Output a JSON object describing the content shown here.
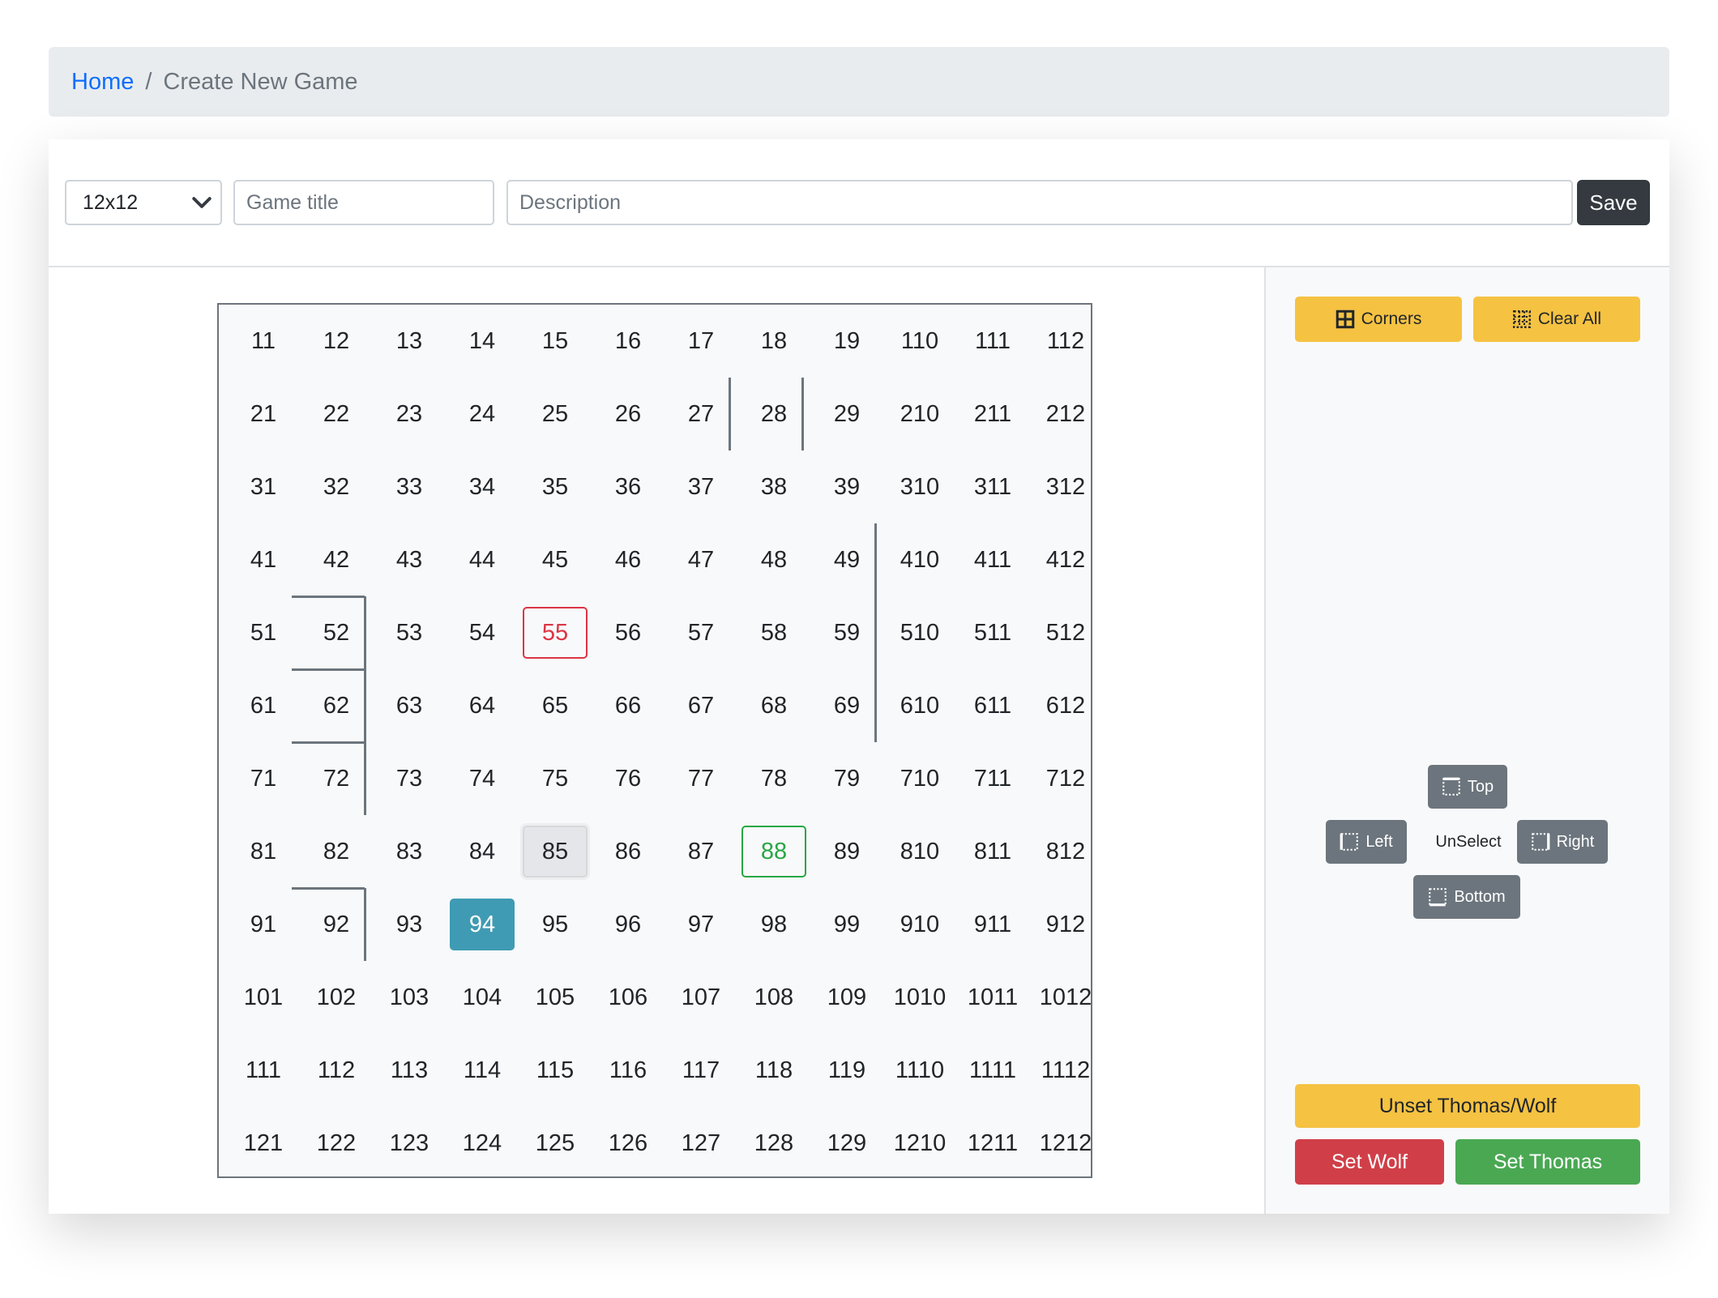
{
  "breadcrumb": {
    "home": "Home",
    "separator": "/",
    "current": "Create New Game"
  },
  "form": {
    "size_select": "12x12",
    "title_placeholder": "Game title",
    "description_placeholder": "Description",
    "save_label": "Save"
  },
  "board": {
    "rows": 12,
    "cols": 12,
    "highlighted": {
      "wolf_cell": "55",
      "thomas_cell": "88",
      "selected_cell": "85",
      "active_cell": "94"
    },
    "cells": [
      [
        "11",
        "12",
        "13",
        "14",
        "15",
        "16",
        "17",
        "18",
        "19",
        "110",
        "111",
        "112"
      ],
      [
        "21",
        "22",
        "23",
        "24",
        "25",
        "26",
        "27",
        "28",
        "29",
        "210",
        "211",
        "212"
      ],
      [
        "31",
        "32",
        "33",
        "34",
        "35",
        "36",
        "37",
        "38",
        "39",
        "310",
        "311",
        "312"
      ],
      [
        "41",
        "42",
        "43",
        "44",
        "45",
        "46",
        "47",
        "48",
        "49",
        "410",
        "411",
        "412"
      ],
      [
        "51",
        "52",
        "53",
        "54",
        "55",
        "56",
        "57",
        "58",
        "59",
        "510",
        "511",
        "512"
      ],
      [
        "61",
        "62",
        "63",
        "64",
        "65",
        "66",
        "67",
        "68",
        "69",
        "610",
        "611",
        "612"
      ],
      [
        "71",
        "72",
        "73",
        "74",
        "75",
        "76",
        "77",
        "78",
        "79",
        "710",
        "711",
        "712"
      ],
      [
        "81",
        "82",
        "83",
        "84",
        "85",
        "86",
        "87",
        "88",
        "89",
        "810",
        "811",
        "812"
      ],
      [
        "91",
        "92",
        "93",
        "94",
        "95",
        "96",
        "97",
        "98",
        "99",
        "910",
        "911",
        "912"
      ],
      [
        "101",
        "102",
        "103",
        "104",
        "105",
        "106",
        "107",
        "108",
        "109",
        "1010",
        "1011",
        "1012"
      ],
      [
        "111",
        "112",
        "113",
        "114",
        "115",
        "116",
        "117",
        "118",
        "119",
        "1110",
        "1111",
        "1112"
      ],
      [
        "121",
        "122",
        "123",
        "124",
        "125",
        "126",
        "127",
        "128",
        "129",
        "1210",
        "1211",
        "1212"
      ]
    ]
  },
  "sidebar": {
    "corners_label": "Corners",
    "clear_all_label": "Clear All",
    "top_label": "Top",
    "left_label": "Left",
    "unselect_label": "UnSelect",
    "right_label": "Right",
    "bottom_label": "Bottom",
    "unset_label": "Unset Thomas/Wolf",
    "set_wolf_label": "Set Wolf",
    "set_thomas_label": "Set Thomas"
  },
  "colors": {
    "link": "#0d6efd",
    "warning": "#f5c242",
    "danger": "#d03f48",
    "success": "#4aa853",
    "info": "#3f9bb3",
    "dark": "#343a40",
    "secondary": "#6c757d"
  }
}
